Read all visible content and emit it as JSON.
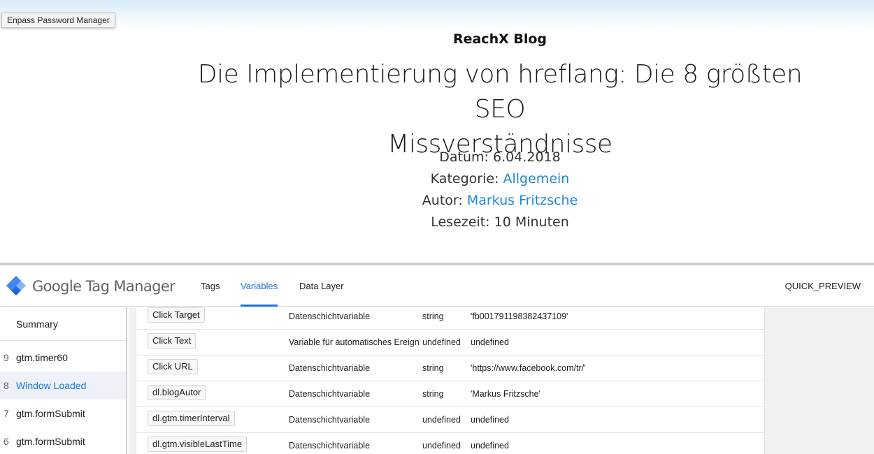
{
  "enpass": {
    "label": "Enpass Password Manager"
  },
  "blog": {
    "brand": "ReachX Blog",
    "title_line1": "Die Implementierung von hreflang: Die 8 größten SEO",
    "title_line2": "Missverständnisse",
    "date_label": "Datum:",
    "date_value": "6.04.2018",
    "category_label": "Kategorie:",
    "category_value": "Allgemein",
    "author_label": "Autor:",
    "author_value": "Markus Fritzsche",
    "reading_label": "Lesezeit:",
    "reading_value": "10 Minuten",
    "link_color": "#1e88d6"
  },
  "gtm": {
    "brand_google": "Google",
    "brand_rest": " Tag Manager",
    "logo_icon": "gtm-diamond-icon",
    "accent": "#1a73e8",
    "tabs": [
      {
        "label": "Tags",
        "active": false
      },
      {
        "label": "Variables",
        "active": true
      },
      {
        "label": "Data Layer",
        "active": false
      }
    ],
    "quick_preview": "QUICK_PREVIEW",
    "sidebar": {
      "summary": "Summary",
      "items": [
        {
          "num": "9",
          "label": "gtm.timer60",
          "selected": false
        },
        {
          "num": "8",
          "label": "Window Loaded",
          "selected": true
        },
        {
          "num": "7",
          "label": "gtm.formSubmit",
          "selected": false
        },
        {
          "num": "6",
          "label": "gtm.formSubmit",
          "selected": false
        }
      ]
    },
    "rows": [
      {
        "name": "Click Target",
        "type": "Datenschichtvariable",
        "dtype": "string",
        "value": "'fb001791198382437109'"
      },
      {
        "name": "Click Text",
        "type": "Variable für automatisches Ereignis",
        "dtype": "undefined",
        "value": "undefined"
      },
      {
        "name": "Click URL",
        "type": "Datenschichtvariable",
        "dtype": "string",
        "value": "'https://www.facebook.com/tr/'"
      },
      {
        "name": "dl.blogAutor",
        "type": "Datenschichtvariable",
        "dtype": "string",
        "value": "'Markus Fritzsche'"
      },
      {
        "name": "dl.gtm.timerInterval",
        "type": "Datenschichtvariable",
        "dtype": "undefined",
        "value": "undefined"
      },
      {
        "name": "dl.gtm.visibleLastTime",
        "type": "Datenschichtvariable",
        "dtype": "undefined",
        "value": "undefined"
      }
    ]
  }
}
